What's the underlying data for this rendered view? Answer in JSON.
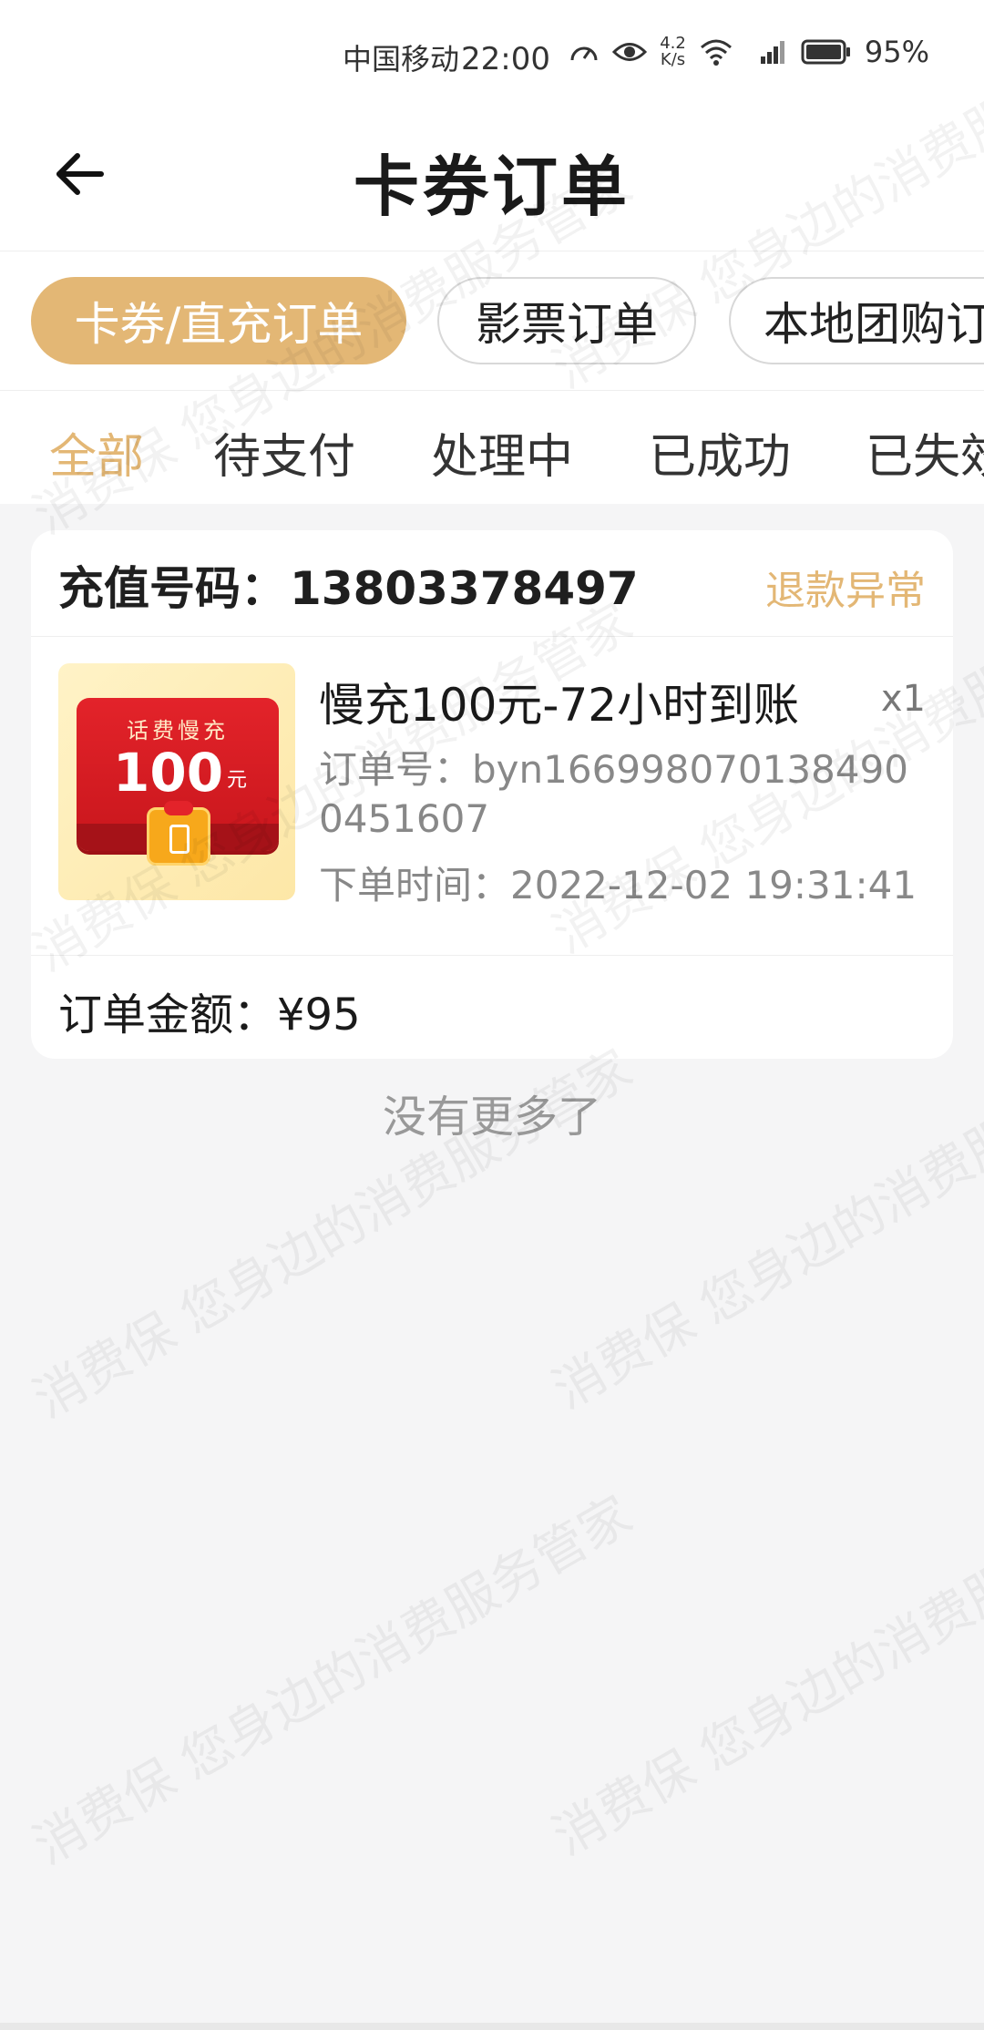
{
  "status_bar": {
    "carrier": "中国移动",
    "time": "22:00",
    "net_speed_value": "4.2",
    "net_speed_unit": "K/s",
    "battery_percent": "95%",
    "icons": [
      "speed-gauge-icon",
      "eye-icon",
      "wifi-icon",
      "signal-5g-icon",
      "battery-icon"
    ]
  },
  "header": {
    "back_icon": "arrow-left-icon",
    "title": "卡券订单"
  },
  "category_tabs": [
    {
      "label": "卡券/直充订单",
      "active": true
    },
    {
      "label": "影票订单",
      "active": false
    },
    {
      "label": "本地团购订单",
      "active": false
    }
  ],
  "status_tabs": [
    {
      "label": "全部",
      "active": true
    },
    {
      "label": "待支付",
      "active": false
    },
    {
      "label": "处理中",
      "active": false
    },
    {
      "label": "已成功",
      "active": false
    },
    {
      "label": "已失效",
      "active": false
    }
  ],
  "order": {
    "phone_label": "充值号码：",
    "phone_number": "13803378497",
    "status": "退款异常",
    "product_image": {
      "line1": "话费慢充",
      "amount": "100",
      "unit": "元",
      "icon": "phone-recharge-icon"
    },
    "product_title": "慢充100元-72小时到账",
    "quantity": "x1",
    "order_no_label": "订单号：",
    "order_no": "byn1669980701384900451607",
    "order_time_label": "下单时间：",
    "order_time": "2022-12-02 19:31:41",
    "amount_label": "订单金额：",
    "amount": "¥95"
  },
  "footer_text": "没有更多了",
  "watermark_text": "消费保 您身边的消费服务管家",
  "colors": {
    "accent": "#e3b775",
    "background": "#f5f5f6",
    "card": "#ffffff"
  }
}
